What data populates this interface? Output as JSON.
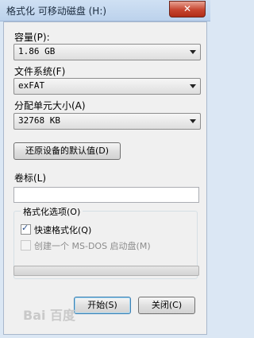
{
  "window": {
    "title": "格式化 可移动磁盘 (H:)",
    "close_symbol": "✕"
  },
  "capacity": {
    "label": "容量(P):",
    "value": "1.86 GB"
  },
  "filesystem": {
    "label": "文件系统(F)",
    "value": "exFAT"
  },
  "allocation": {
    "label": "分配单元大小(A)",
    "value": "32768 KB"
  },
  "restore_button": "还原设备的默认值(D)",
  "volume": {
    "label": "卷标(L)",
    "value": ""
  },
  "format_options": {
    "title": "格式化选项(O)",
    "quick_format": {
      "label": "快速格式化(Q)",
      "checked": true
    },
    "msdos_startup": {
      "label": "创建一个 MS-DOS 启动盘(M)",
      "checked": false,
      "enabled": false
    }
  },
  "progress": {
    "fraction": 0
  },
  "buttons": {
    "start": "开始(S)",
    "close": "关闭(C)"
  },
  "watermark": "Bai 百度"
}
